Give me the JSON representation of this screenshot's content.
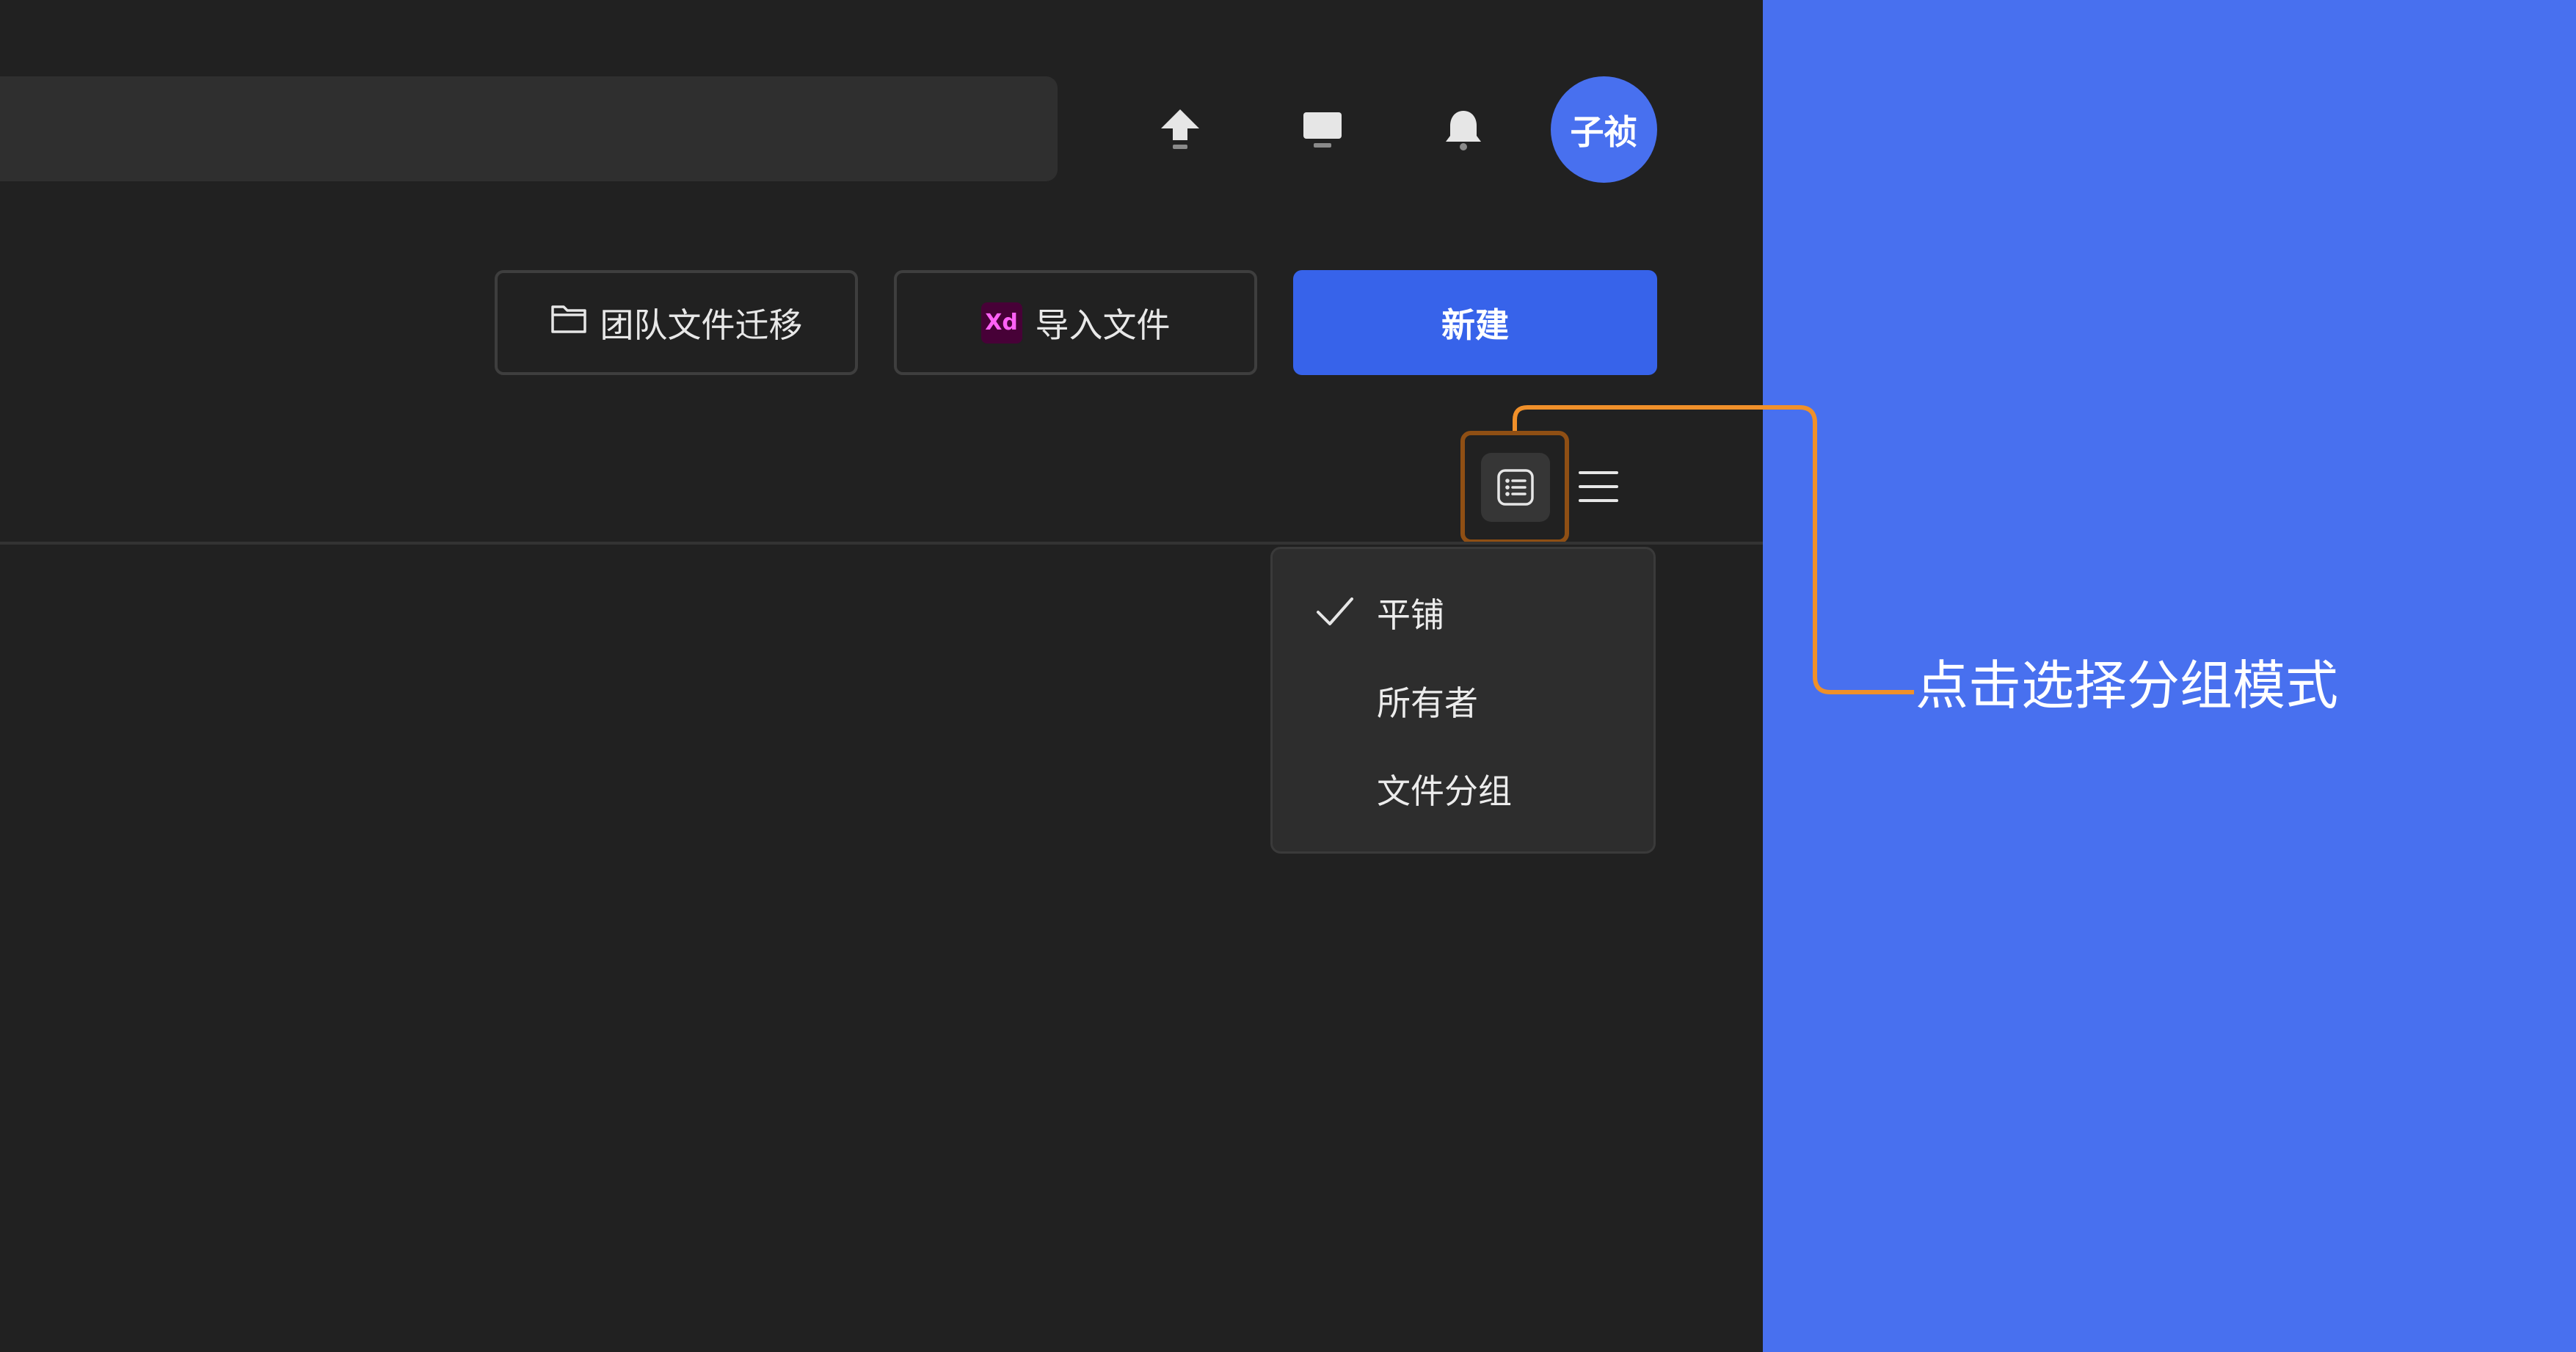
{
  "header": {
    "avatar_text": "子祯",
    "icons": [
      "upload-icon",
      "monitor-icon",
      "bell-icon"
    ]
  },
  "actions": {
    "migrate_label": "团队文件迁移",
    "import_badge": "Xd",
    "import_label": "导入文件",
    "new_label": "新建"
  },
  "view_menu": {
    "items": [
      {
        "label": "平铺",
        "checked": true
      },
      {
        "label": "所有者",
        "checked": false
      },
      {
        "label": "文件分组",
        "checked": false
      }
    ]
  },
  "annotation": {
    "text": "点击选择分组模式"
  },
  "colors": {
    "background": "#212121",
    "side_panel": "#4870ef",
    "primary": "#3763ea",
    "callout": "#f0902a"
  }
}
